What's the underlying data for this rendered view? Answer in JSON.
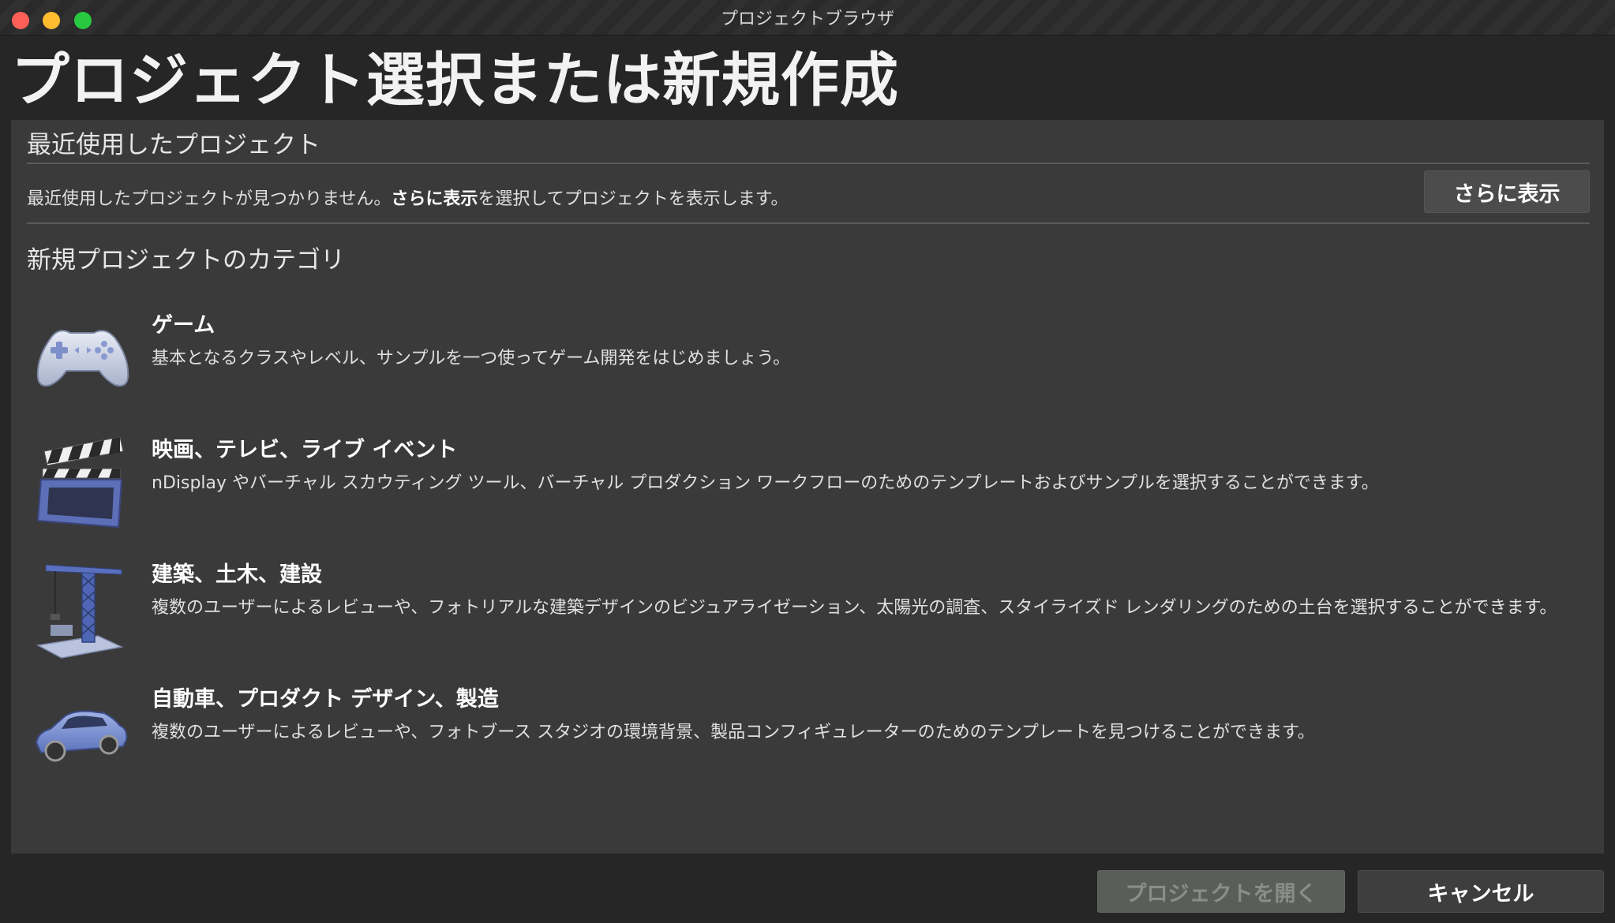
{
  "window": {
    "title": "プロジェクトブラウザ"
  },
  "page": {
    "title": "プロジェクト選択または新規作成"
  },
  "recent": {
    "heading": "最近使用したプロジェクト",
    "message_prefix": "最近使用したプロジェクトが見つかりません。",
    "message_bold": "さらに表示",
    "message_suffix": "を選択してプロジェクトを表示します。",
    "more_button": "さらに表示"
  },
  "categories": {
    "heading": "新規プロジェクトのカテゴリ",
    "items": [
      {
        "name": "ゲーム",
        "description": "基本となるクラスやレベル、サンプルを一つ使ってゲーム開発をはじめましょう。",
        "icon": "gamepad-icon"
      },
      {
        "name": "映画、テレビ、ライブ イベント",
        "description": "nDisplay やバーチャル スカウティング ツール、バーチャル プロダクション ワークフローのためのテンプレートおよびサンプルを選択することができます。",
        "icon": "clapperboard-icon"
      },
      {
        "name": "建築、土木、建設",
        "description": "複数のユーザーによるレビューや、フォトリアルな建築デザインのビジュアライゼーション、太陽光の調査、スタイライズド レンダリングのための土台を選択することができます。",
        "icon": "crane-icon"
      },
      {
        "name": "自動車、プロダクト デザイン、製造",
        "description": "複数のユーザーによるレビューや、フォトブース スタジオの環境背景、製品コンフィギュレーターのためのテンプレートを見つけることができます。",
        "icon": "car-icon"
      }
    ]
  },
  "footer": {
    "open_button": "プロジェクトを開く",
    "cancel_button": "キャンセル"
  },
  "colors": {
    "background": "#262626",
    "panel": "#3a3a3a",
    "close": "#fe5f57",
    "minimize": "#febc2e",
    "maximize": "#28c840"
  }
}
